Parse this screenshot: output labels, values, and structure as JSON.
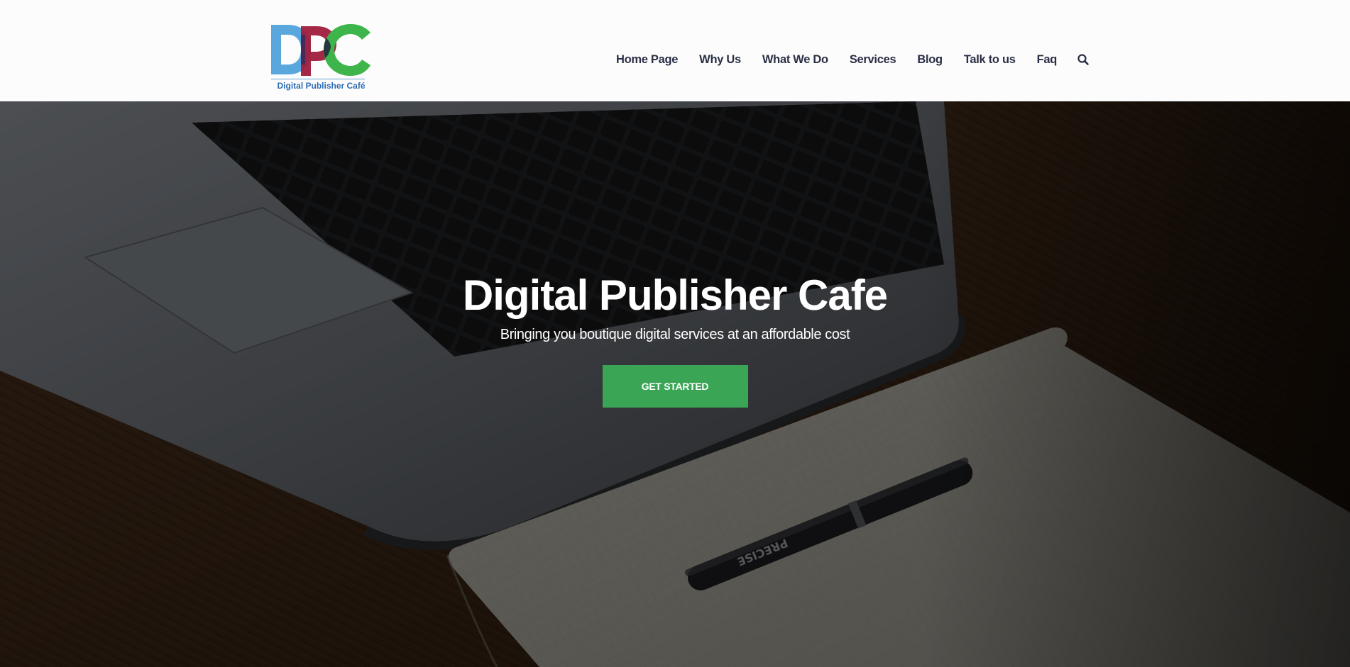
{
  "brand": {
    "logo_letters": "DPC",
    "logo_caption": "Digital Publisher Café",
    "colors": {
      "d": "#5aa7de",
      "p": "#9c1b3a",
      "c": "#3db54a"
    }
  },
  "nav": {
    "items": [
      {
        "label": "Home Page"
      },
      {
        "label": "Why Us"
      },
      {
        "label": "What We Do"
      },
      {
        "label": "Services"
      },
      {
        "label": "Blog"
      },
      {
        "label": "Talk to us"
      },
      {
        "label": "Faq"
      }
    ],
    "search_icon": "search-icon",
    "text_color": "#2a2f45"
  },
  "hero": {
    "title": "Digital Publisher Cafe",
    "subtitle": "Bringing you boutique digital services at an affordable cost",
    "cta_label": "GET STARTED",
    "cta_color": "#3aa655",
    "pen_print": "PRECISE"
  }
}
